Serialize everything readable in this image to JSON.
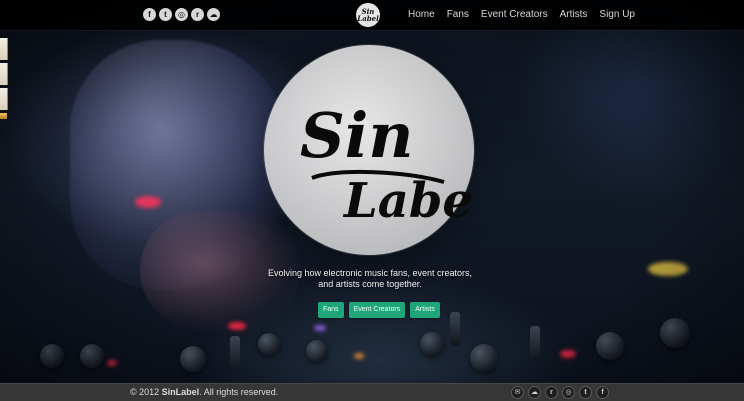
{
  "nav": {
    "logo_text_line1": "Sin",
    "logo_text_line2": "Label",
    "items": [
      {
        "label": "Home"
      },
      {
        "label": "Fans"
      },
      {
        "label": "Event Creators"
      },
      {
        "label": "Artists"
      },
      {
        "label": "Sign Up"
      }
    ],
    "social_top": [
      {
        "name": "facebook-icon",
        "glyph": "f"
      },
      {
        "name": "twitter-icon",
        "glyph": "t"
      },
      {
        "name": "instagram-icon",
        "glyph": "◎"
      },
      {
        "name": "rss-icon",
        "glyph": "r"
      },
      {
        "name": "soundcloud-icon",
        "glyph": "☁"
      }
    ]
  },
  "hero": {
    "logo_text_line1": "Sin",
    "logo_text_line2": "Label",
    "tagline": "Evolving how electronic music fans, event creators, and artists come together.",
    "buttons": [
      {
        "label": "Fans"
      },
      {
        "label": "Event Creators"
      },
      {
        "label": "Artists"
      }
    ]
  },
  "footer": {
    "copyright_prefix": "© 2012",
    "brand": "SinLabel",
    "copyright_suffix": ". All rights reserved.",
    "social_bottom": [
      {
        "name": "mail-icon",
        "glyph": "✉"
      },
      {
        "name": "soundcloud-icon",
        "glyph": "☁"
      },
      {
        "name": "rss-icon",
        "glyph": "r"
      },
      {
        "name": "instagram-icon",
        "glyph": "◎"
      },
      {
        "name": "twitter-icon",
        "glyph": "t"
      },
      {
        "name": "facebook-icon",
        "glyph": "f"
      }
    ]
  },
  "colors": {
    "accent": "#1ea678",
    "topbar": "#000000",
    "footer": "#363636",
    "logo_circle": "#e6e6e6"
  }
}
